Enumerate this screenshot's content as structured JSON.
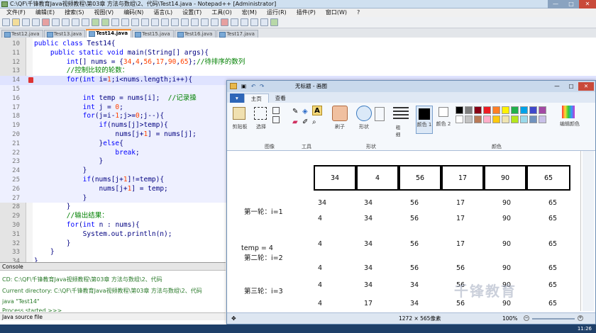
{
  "window": {
    "title": "C:\\QF\\千锋教育Java视频教程\\第03章 方法与数组\\2、代码\\Test14.java - Notepad++ [Administrator]"
  },
  "menu": [
    "文件(F)",
    "编辑(E)",
    "搜索(S)",
    "视图(V)",
    "编码(N)",
    "语言(L)",
    "设置(T)",
    "工具(O)",
    "宏(M)",
    "运行(R)",
    "插件(P)",
    "窗口(W)",
    "?"
  ],
  "tabs": [
    "Test12.java",
    "Test13.java",
    "Test14.java",
    "Test15.java",
    "Test16.java",
    "Test17.java"
  ],
  "active_tab": 2,
  "lines": [
    {
      "n": "10",
      "t": "public class Test14{"
    },
    {
      "n": "11",
      "t": "    public static void main(String[] args){"
    },
    {
      "n": "12",
      "t": "        int[] nums = {34,4,56,17,90,65};//待排序的数列"
    },
    {
      "n": "13",
      "t": "        //控制比较的轮数："
    },
    {
      "n": "14",
      "t": "        for(int i=1;i<nums.length;i++){"
    },
    {
      "n": "15",
      "t": ""
    },
    {
      "n": "16",
      "t": "            int temp = nums[i];  //记录操"
    },
    {
      "n": "17",
      "t": "            int j = 0;"
    },
    {
      "n": "18",
      "t": "            for(j=i-1;j>=0;j--){"
    },
    {
      "n": "19",
      "t": "                if(nums[j]>temp){"
    },
    {
      "n": "20",
      "t": "                    nums[j+1] = nums[j];"
    },
    {
      "n": "21",
      "t": "                }else{"
    },
    {
      "n": "22",
      "t": "                    break;"
    },
    {
      "n": "23",
      "t": "                }"
    },
    {
      "n": "24",
      "t": "            }"
    },
    {
      "n": "25",
      "t": "            if(nums[j+1]!=temp){"
    },
    {
      "n": "26",
      "t": "                nums[j+1] = temp;"
    },
    {
      "n": "27",
      "t": "            }"
    },
    {
      "n": "28",
      "t": "        }"
    },
    {
      "n": "29",
      "t": "        //输出结果："
    },
    {
      "n": "30",
      "t": "        for(int n : nums){"
    },
    {
      "n": "31",
      "t": "            System.out.println(n);"
    },
    {
      "n": "32",
      "t": "        }"
    },
    {
      "n": "33",
      "t": "    }"
    },
    {
      "n": "34",
      "t": "}"
    }
  ],
  "console": {
    "header": "Console",
    "lines": [
      "CD: C:\\QF\\千锋教育Java视频教程\\第03章 方法与数组\\2、代码",
      "Current directory: C:\\QF\\千锋教育Java视频教程\\第03章 方法与数组\\2、代码",
      "java \"Test14\"",
      "Process started >>>"
    ]
  },
  "status": "Java source file",
  "paint": {
    "title": "无标题 - 画图",
    "tabs": [
      "主页",
      "查看"
    ],
    "groups": {
      "clipboard": "剪贴板",
      "select": "选择",
      "image": "图像",
      "tools": "工具",
      "brush": "刷子",
      "shapes": "形状",
      "outline": "粗细",
      "color1": "颜色 1",
      "color2": "颜色 2",
      "colors": "颜色",
      "edit_colors": "编辑颜色",
      "shape_group": "形状"
    },
    "temp_label": "temp =",
    "temp_value": "4",
    "array": [
      "34",
      "4",
      "56",
      "17",
      "90",
      "65"
    ],
    "row_labels": [
      "第一轮：i=1",
      "第二轮：i=2",
      "第三轮：i=3"
    ],
    "status_size": "1272 × 565像素",
    "zoom": "100%"
  },
  "palette": [
    "#000000",
    "#7f7f7f",
    "#880015",
    "#ed1c24",
    "#ff7f27",
    "#fff200",
    "#22b14c",
    "#00a2e8",
    "#3f48cc",
    "#a349a4",
    "#ffffff",
    "#c3c3c3",
    "#b97a57",
    "#ffaec9",
    "#ffc90e",
    "#efe4b0",
    "#b5e61d",
    "#99d9ea",
    "#7092be",
    "#c8bfe7"
  ],
  "watermark": "千锋教育",
  "clock": "11:26"
}
